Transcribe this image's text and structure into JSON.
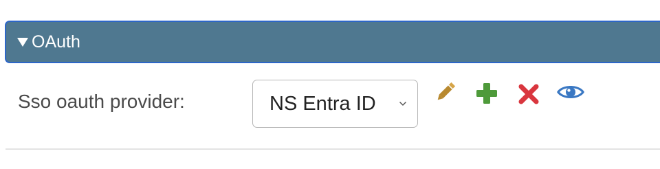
{
  "section": {
    "title": "OAuth",
    "header_bg": "#4f7890",
    "header_border": "#2d66c7"
  },
  "form": {
    "field_label": "Sso oauth provider:",
    "selected_provider": "NS Entra ID"
  },
  "actions": [
    {
      "name": "edit",
      "icon": "pencil-icon",
      "color": "#b8892f"
    },
    {
      "name": "add",
      "icon": "plus-icon",
      "color": "#4e9a3a"
    },
    {
      "name": "delete",
      "icon": "close-icon",
      "color": "#d9363e"
    },
    {
      "name": "view",
      "icon": "eye-icon",
      "color": "#3a78c3"
    }
  ]
}
